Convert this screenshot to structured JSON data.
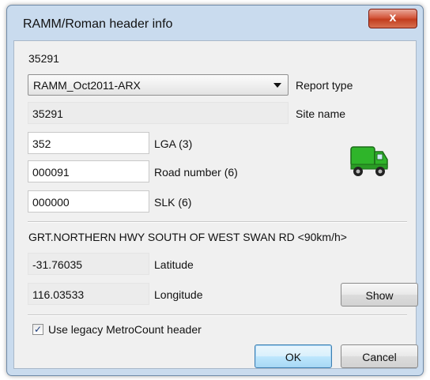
{
  "window": {
    "title": "RAMM/Roman header info",
    "close_glyph": "x"
  },
  "site_id_text": "35291",
  "report_type": {
    "selected": "RAMM_Oct2011-ARX",
    "label": "Report type"
  },
  "site_name": {
    "value": "35291",
    "label": "Site name"
  },
  "lga": {
    "value": "352",
    "label": "LGA (3)"
  },
  "road_number": {
    "value": "000091",
    "label": "Road number (6)"
  },
  "slk": {
    "value": "000000",
    "label": "SLK (6)"
  },
  "road_description": "GRT.NORTHERN HWY SOUTH OF WEST SWAN RD <90km/h>",
  "latitude": {
    "value": "-31.76035",
    "label": "Latitude"
  },
  "longitude": {
    "value": "116.03533",
    "label": "Longitude"
  },
  "show_button": "Show",
  "legacy_header": {
    "checked": true,
    "check_glyph": "✓",
    "label": "Use legacy MetroCount header"
  },
  "buttons": {
    "ok": "OK",
    "cancel": "Cancel"
  },
  "icons": {
    "vehicle": "green-truck-icon"
  },
  "colors": {
    "truck_green": "#2fb52a",
    "titlebar": "#c9dbee",
    "close_red": "#c23d1e"
  }
}
